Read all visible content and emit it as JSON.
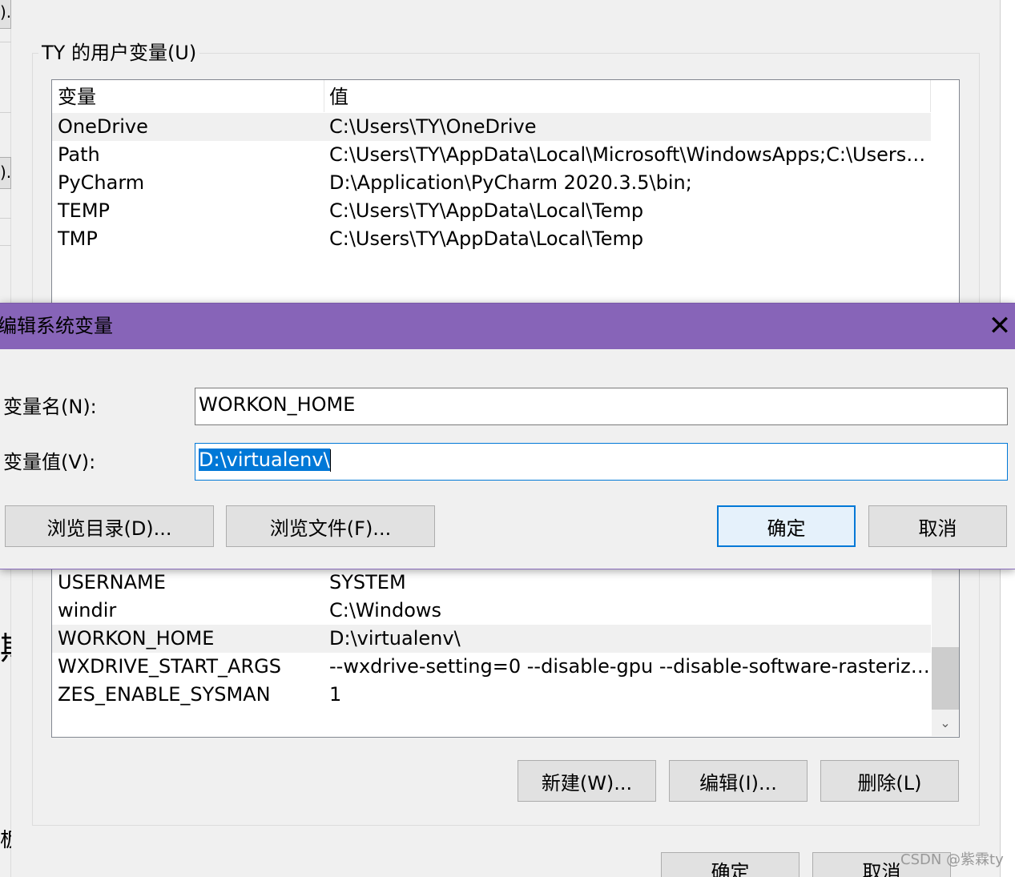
{
  "parent_window": {
    "fragments": [
      ").",
      ").",
      "期",
      "板"
    ]
  },
  "user_vars": {
    "group_title": "TY 的用户变量(U)",
    "columns": [
      "变量",
      "值"
    ],
    "rows": [
      {
        "name": "OneDrive",
        "value": "C:\\Users\\TY\\OneDrive"
      },
      {
        "name": "Path",
        "value": "C:\\Users\\TY\\AppData\\Local\\Microsoft\\WindowsApps;C:\\Users\\T..."
      },
      {
        "name": "PyCharm",
        "value": "D:\\Application\\PyCharm 2020.3.5\\bin;"
      },
      {
        "name": "TEMP",
        "value": "C:\\Users\\TY\\AppData\\Local\\Temp"
      },
      {
        "name": "TMP",
        "value": "C:\\Users\\TY\\AppData\\Local\\Temp"
      }
    ]
  },
  "system_vars": {
    "rows": [
      {
        "name": "USERNAME",
        "value": "SYSTEM"
      },
      {
        "name": "windir",
        "value": "C:\\Windows"
      },
      {
        "name": "WORKON_HOME",
        "value": "D:\\virtualenv\\"
      },
      {
        "name": "WXDRIVE_START_ARGS",
        "value": "--wxdrive-setting=0 --disable-gpu --disable-software-rasterizer..."
      },
      {
        "name": "ZES_ENABLE_SYSMAN",
        "value": "1"
      }
    ],
    "buttons": {
      "new": "新建(W)...",
      "edit": "编辑(I)...",
      "delete": "删除(L)"
    }
  },
  "main_buttons": {
    "ok": "确定",
    "cancel": "取消"
  },
  "dialog": {
    "title": "编辑系统变量",
    "close_glyph": "✕",
    "name_label": "变量名(N):",
    "name_value": "WORKON_HOME",
    "value_label": "变量值(V):",
    "value_value": "D:\\virtualenv\\",
    "buttons": {
      "browse_dir": "浏览目录(D)...",
      "browse_file": "浏览文件(F)...",
      "ok": "确定",
      "cancel": "取消"
    }
  },
  "scroll_glyph": "⌄",
  "watermark": "CSDN @紫霖ty",
  "colors": {
    "title_bar": "#8764b8",
    "selection": "#0078d7"
  }
}
